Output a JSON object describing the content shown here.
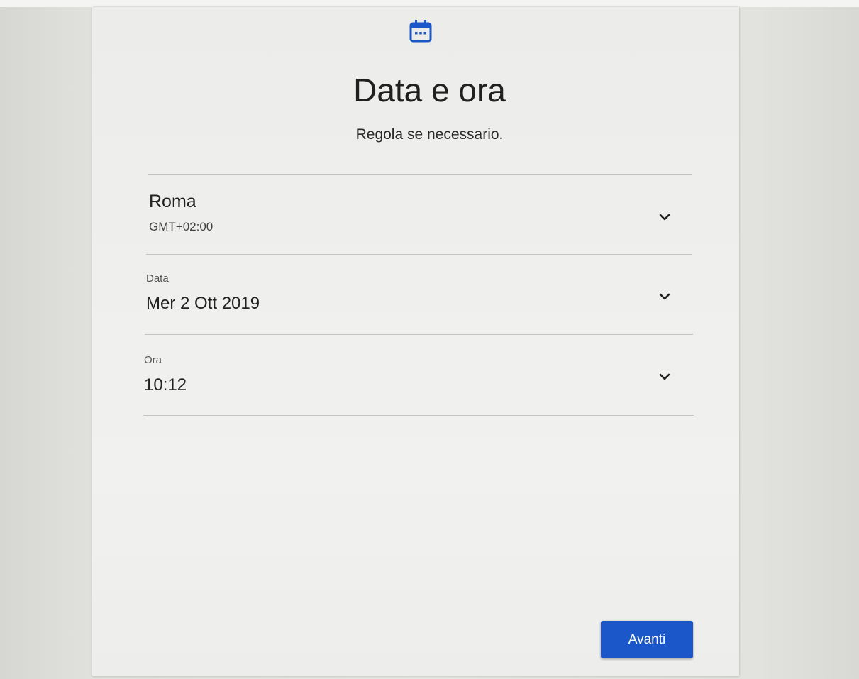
{
  "header": {
    "icon": "calendar-icon",
    "title": "Data e ora",
    "subtitle": "Regola se necessario."
  },
  "timezone": {
    "city": "Roma",
    "offset": "GMT+02:00"
  },
  "date": {
    "label": "Data",
    "value": "Mer 2 Ott 2019"
  },
  "time": {
    "label": "Ora",
    "value": "10:12"
  },
  "footer": {
    "next_label": "Avanti"
  },
  "colors": {
    "accent": "#1b57c9",
    "icon": "#1b57c9"
  }
}
